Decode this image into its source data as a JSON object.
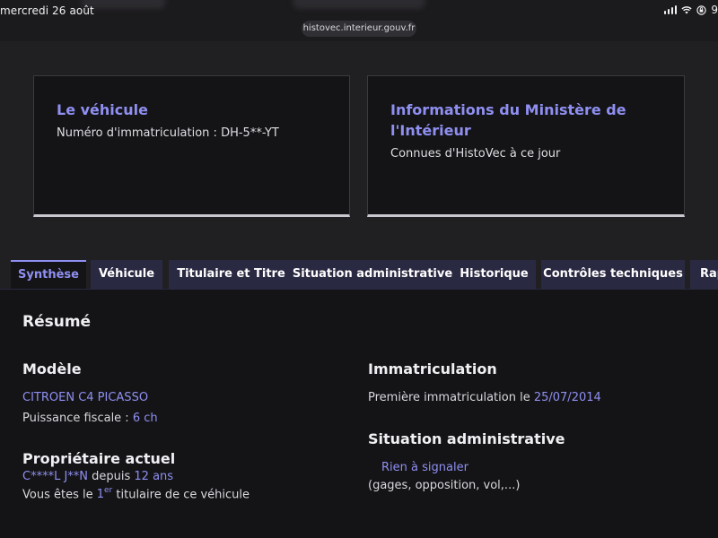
{
  "status": {
    "date": "mercredi 26 août",
    "battery": "9",
    "url": "histovec.interieur.gouv.fr"
  },
  "cards": {
    "vehicule": {
      "title": "Le véhicule",
      "immat_label": "Numéro d'immatriculation : ",
      "immat_value": "DH-5**-YT"
    },
    "ministere": {
      "title_line1": "Informations du Ministère de",
      "title_line2": "l'Intérieur",
      "subtitle": "Connues d'HistoVec à ce jour"
    }
  },
  "tabs": [
    {
      "label": "Synthèse",
      "active": true
    },
    {
      "label": "Véhicule",
      "active": false
    },
    {
      "label": "Titulaire et Titre",
      "active": false
    },
    {
      "label": "Situation administrative",
      "active": false
    },
    {
      "label": "Historique",
      "active": false
    },
    {
      "label": "Contrôles techniques",
      "active": false
    },
    {
      "label": "Rap",
      "active": false
    }
  ],
  "resume": {
    "title": "Résumé",
    "modele": {
      "title": "Modèle",
      "model_name": "CITROEN C4 PICASSO",
      "puissance_label": "Puissance fiscale : ",
      "puissance_value": "6 ch"
    },
    "proprietaire": {
      "title": "Propriétaire actuel",
      "name": "C****L J**N",
      "depuis": " depuis ",
      "duration": "12 ans",
      "rank_prefix": "Vous êtes le ",
      "rank_number": "1",
      "rank_sup": "er",
      "rank_suffix": " titulaire de ce véhicule"
    },
    "immatriculation": {
      "title": "Immatriculation",
      "first_label": "Première immatriculation le ",
      "first_date": "25/07/2014"
    },
    "situation": {
      "title": "Situation administrative",
      "status": "Rien à signaler",
      "detail": "(gages, opposition, vol,...)"
    }
  },
  "colors": {
    "accent": "#8f8ff2",
    "background": "#201f22",
    "panel": "#141416",
    "tab": "#2a2942"
  }
}
